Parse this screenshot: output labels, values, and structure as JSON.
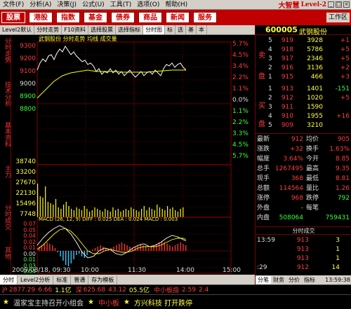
{
  "window": {
    "brand": "大智慧",
    "edition": "Level-2",
    "workspace": "工作区"
  },
  "menu": [
    "文件(F)",
    "分析(A)",
    "决策(J)",
    "公式(U)",
    "工具(T)",
    "选项(O)",
    "帮助(H)"
  ],
  "toolbar": [
    "股票",
    "港股",
    "指数",
    "基金",
    "债券",
    "商品",
    "新闻",
    "服务"
  ],
  "tabs": [
    "Level2默认",
    "分时走势",
    "F10资料",
    "选择股票",
    "选择指标",
    "分时图",
    "标",
    "选",
    "基",
    "本"
  ],
  "left_tabs": [
    "分时走势",
    "技术分析",
    "基本资料",
    "主力",
    "分时成交",
    "其他"
  ],
  "chart": {
    "legend": "武钢股份  分时走势  均线  成交量",
    "price_left": [
      "9300",
      "9200",
      "9100",
      "9000",
      "8900",
      "8800"
    ],
    "pct_right": [
      "5.7%",
      "4.5%",
      "3.4%",
      "2.2%",
      "1.1%",
      "0.0%",
      "1.1%",
      "2.2%",
      "3.3%",
      "4.5%",
      "5.7%"
    ],
    "vol_left": [
      "38740",
      "33200",
      "27670",
      "22130",
      "15496",
      "7748"
    ],
    "macd_label": "MACD (26, 12, 9)  DIFF : 0.025  DEA : 0.024  MACD : 0.003",
    "macd_left": [
      "0.07",
      "0.05",
      "0.04",
      "0.02",
      "0.01",
      "0.00",
      "0.01",
      "0.03",
      "0.04"
    ],
    "date": "2009/08/18, 09:30",
    "times": [
      "10:00",
      "11:30",
      "14:00",
      "15:00"
    ]
  },
  "quote": {
    "code": "600005",
    "name": "武钢股份",
    "ask_label": "卖",
    "ask_label2": "盘",
    "bid_label": "买",
    "bid_label2": "盘",
    "asks": [
      {
        "lv": "5",
        "price": "919",
        "vol": "3928",
        "chg": "+1"
      },
      {
        "lv": "4",
        "price": "918",
        "vol": "5786",
        "chg": "+5"
      },
      {
        "lv": "3",
        "price": "917",
        "vol": "2346",
        "chg": "+5"
      },
      {
        "lv": "2",
        "price": "916",
        "vol": "3136",
        "chg": "+2"
      },
      {
        "lv": "1",
        "price": "915",
        "vol": "466",
        "chg": "+3"
      }
    ],
    "bids": [
      {
        "lv": "1",
        "price": "913",
        "vol": "1401",
        "chg": "-151"
      },
      {
        "lv": "2",
        "price": "912",
        "vol": "1020",
        "chg": "+5"
      },
      {
        "lv": "3",
        "price": "911",
        "vol": "1590",
        "chg": ""
      },
      {
        "lv": "4",
        "price": "910",
        "vol": "1955",
        "chg": "+16"
      },
      {
        "lv": "5",
        "price": "909",
        "vol": "3210",
        "chg": ""
      }
    ],
    "stats": [
      {
        "l": "最新",
        "v": "912",
        "l2": "均价",
        "v2": "905"
      },
      {
        "l": "涨跌",
        "v": "+32",
        "l2": "换手",
        "v2": "1.63%"
      },
      {
        "l": "幅度",
        "v": "3.64%",
        "l2": "今开",
        "v2": "8.85"
      },
      {
        "l": "总手",
        "v": "1267495",
        "l2": "最高",
        "v2": "9.35"
      },
      {
        "l": "现手",
        "v": "368",
        "l2": "最低",
        "v2": "8.81"
      },
      {
        "l": "总额",
        "v": "114564",
        "l2": "量比",
        "v2": "1.26"
      },
      {
        "l": "涨停",
        "v": "968",
        "l2": "跌停",
        "v2": "792"
      },
      {
        "l": "外盘",
        "v": "-",
        "l2": "每笔",
        "v2": ""
      },
      {
        "l": "内盘",
        "v": "508064",
        "l2": "",
        "v2": "759431"
      }
    ],
    "trade_header": "分时成交",
    "trades": [
      {
        "t": "13:59",
        "p": "913",
        "v": "3"
      },
      {
        "t": "",
        "p": "913",
        "v": "1"
      },
      {
        "t": "",
        "p": "913",
        "v": "1"
      },
      {
        "t": ":29",
        "p": "912",
        "v": "14"
      }
    ],
    "bottom_tabs": [
      "分笔",
      "财务",
      "分价",
      "指标",
      "13:59:38"
    ]
  },
  "bottom_tabs": [
    "分时",
    "Level2分析",
    "标准",
    "普通",
    "存为模板"
  ],
  "status": {
    "sh_label": "沪",
    "sh": "2877.29",
    "sh_chg": "6.66",
    "sh_amt": "1.1亿",
    "sz_label": "深",
    "sz": "625.68",
    "sz_chg": "43.12",
    "sz_amt": "05.5亿",
    "idx_name": "中小板指",
    "idx": "2.59",
    "idx_chg": "2.4"
  },
  "ticker": [
    "温家宝主持召开小组会",
    "中小板",
    "方兴科技 打开跌停"
  ]
}
